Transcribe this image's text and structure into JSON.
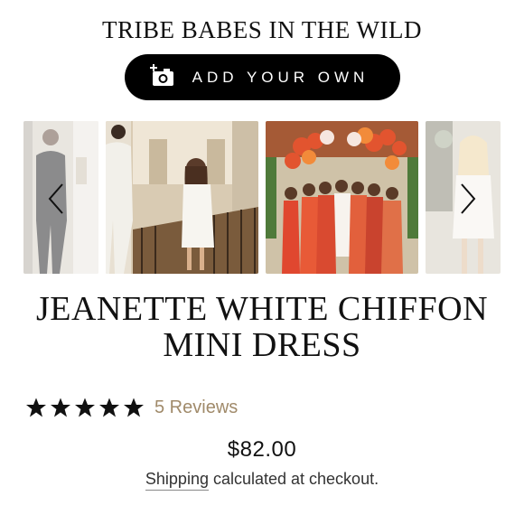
{
  "section": {
    "title": "TRIBE BABES IN THE WILD"
  },
  "add_button": {
    "label": "ADD YOUR OWN",
    "icon": "camera-plus-icon"
  },
  "carousel": {
    "slides": [
      {
        "name": "photo-man-in-black"
      },
      {
        "name": "photo-woman-white-dress-staircase"
      },
      {
        "name": "photo-bridal-party-balloons"
      },
      {
        "name": "photo-woman-white-outfit"
      }
    ],
    "prev_icon": "chevron-left-icon",
    "next_icon": "chevron-right-icon"
  },
  "product": {
    "title_line1": "JEANETTE WHITE CHIFFON",
    "title_line2": "MINI DRESS",
    "rating": 5,
    "reviews_label": "5 Reviews",
    "price": "$82.00",
    "shipping_link": "Shipping",
    "shipping_text": " calculated at checkout."
  },
  "colors": {
    "accent_button": "#000000",
    "reviews_text": "#a08a6a",
    "star": "#111111"
  }
}
